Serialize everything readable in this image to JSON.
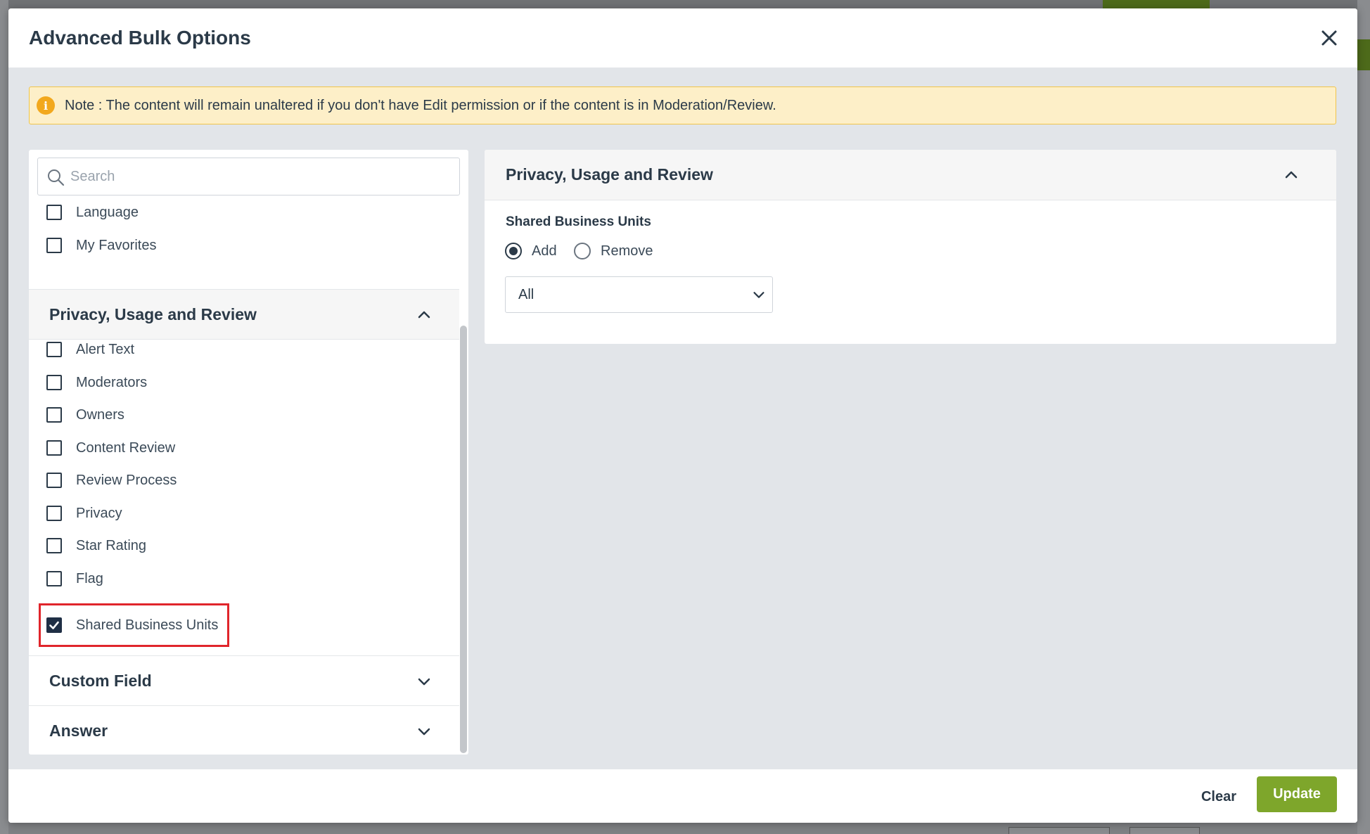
{
  "modal": {
    "title": "Advanced Bulk Options"
  },
  "note": {
    "icon": "info-icon",
    "text": "Note : The content will remain unaltered if you don't have Edit permission or if the content is in Moderation/Review."
  },
  "left_panel": {
    "search": {
      "placeholder": "Search",
      "value": ""
    },
    "top_items": [
      {
        "label": "Language",
        "checked": false
      },
      {
        "label": "My Favorites",
        "checked": false
      }
    ],
    "sections": [
      {
        "title": "Privacy, Usage and Review",
        "expanded": true,
        "items": [
          {
            "label": "Alert Text",
            "checked": false
          },
          {
            "label": "Moderators",
            "checked": false
          },
          {
            "label": "Owners",
            "checked": false
          },
          {
            "label": "Content Review",
            "checked": false
          },
          {
            "label": "Review Process",
            "checked": false
          },
          {
            "label": "Privacy",
            "checked": false
          },
          {
            "label": "Star Rating",
            "checked": false
          },
          {
            "label": "Flag",
            "checked": false
          },
          {
            "label": "Shared Business Units",
            "checked": true
          }
        ]
      },
      {
        "title": "Custom Field",
        "expanded": false
      },
      {
        "title": "Answer",
        "expanded": false
      }
    ]
  },
  "right_panel": {
    "title": "Privacy, Usage and Review",
    "field_label": "Shared Business Units",
    "radio_options": [
      {
        "label": "Add",
        "selected": true
      },
      {
        "label": "Remove",
        "selected": false
      }
    ],
    "select_value": "All"
  },
  "footer": {
    "clear_label": "Clear",
    "update_label": "Update"
  },
  "colors": {
    "accent_green": "#7ea62b",
    "note_bg": "#fdefc8",
    "highlight_red": "#e0252b"
  }
}
